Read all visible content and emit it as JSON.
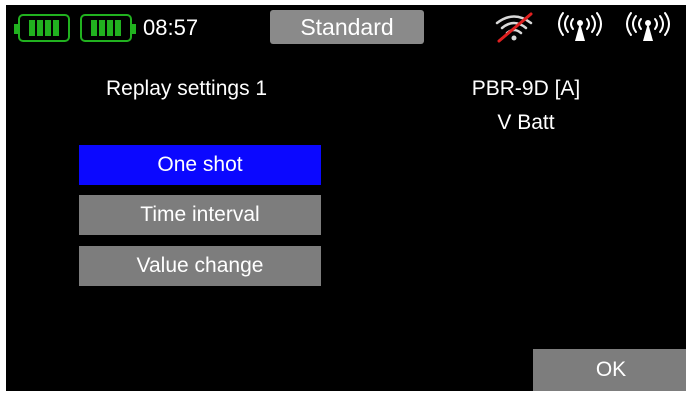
{
  "status_bar": {
    "time": "08:57",
    "mode": "Standard",
    "battery_color": "#21b11f",
    "icons": [
      "battery-tx-icon",
      "battery-rx-icon",
      "no-signal-icon",
      "antenna-icon",
      "antenna-icon"
    ]
  },
  "page": {
    "title": "Replay settings 1",
    "device": "PBR-9D [A]",
    "value": "V Batt"
  },
  "options": [
    {
      "label": "One shot",
      "selected": true
    },
    {
      "label": "Time interval",
      "selected": false
    },
    {
      "label": "Value change",
      "selected": false
    }
  ],
  "colors": {
    "selected": "#0b08ff",
    "button": "#7d7d7d",
    "mode_button": "#8a8a8a",
    "background": "#000000",
    "no_signal_strike": "#e02020"
  },
  "ok_label": "OK"
}
